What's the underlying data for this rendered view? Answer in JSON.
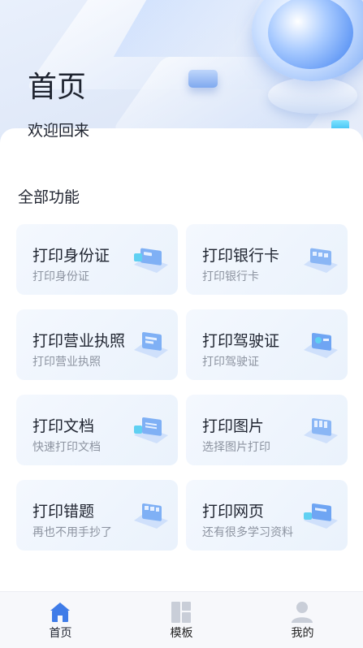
{
  "header": {
    "title": "首页",
    "welcome": "欢迎回来"
  },
  "section": {
    "title": "全部功能"
  },
  "functions": [
    {
      "title": "打印身份证",
      "subtitle": "打印身份证",
      "icon": "id-card-print-icon"
    },
    {
      "title": "打印银行卡",
      "subtitle": "打印银行卡",
      "icon": "bank-card-print-icon"
    },
    {
      "title": "打印营业执照",
      "subtitle": "打印营业执照",
      "icon": "business-license-print-icon"
    },
    {
      "title": "打印驾驶证",
      "subtitle": "打印驾驶证",
      "icon": "driver-license-print-icon"
    },
    {
      "title": "打印文档",
      "subtitle": "快速打印文档",
      "icon": "document-print-icon"
    },
    {
      "title": "打印图片",
      "subtitle": "选择图片打印",
      "icon": "image-print-icon"
    },
    {
      "title": "打印错题",
      "subtitle": "再也不用手抄了",
      "icon": "wrong-question-print-icon"
    },
    {
      "title": "打印网页",
      "subtitle": "还有很多学习资料",
      "icon": "webpage-print-icon"
    }
  ],
  "tabbar": {
    "items": [
      {
        "label": "首页",
        "icon": "home-icon",
        "active": true
      },
      {
        "label": "模板",
        "icon": "template-icon",
        "active": false
      },
      {
        "label": "我的",
        "icon": "profile-icon",
        "active": false
      }
    ]
  },
  "colors": {
    "accent": "#3f7ce8",
    "inactive_icon": "#c9ced8",
    "tile_bg": "#eef4fc"
  }
}
